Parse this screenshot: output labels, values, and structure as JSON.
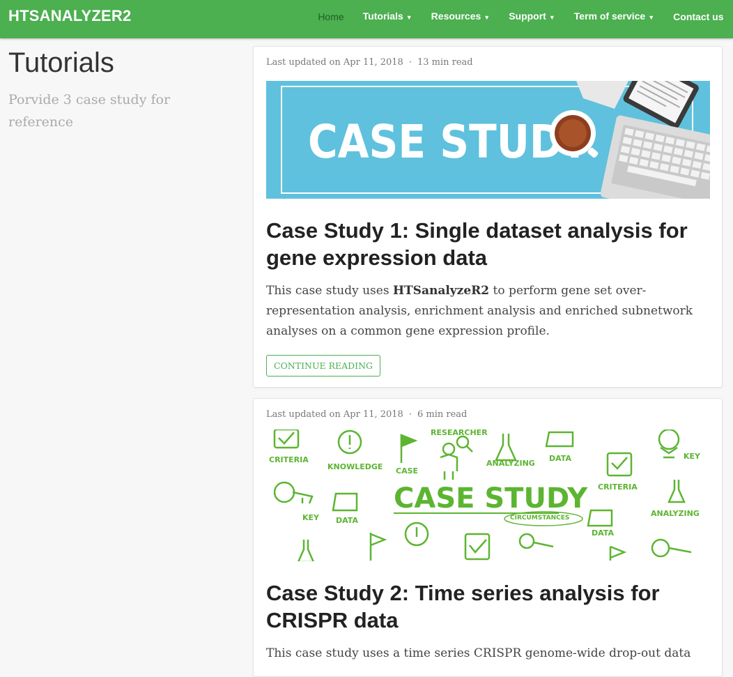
{
  "navbar": {
    "brand": "HTSANALYZER2",
    "items": [
      {
        "label": "Home",
        "dropdown": false,
        "active": true
      },
      {
        "label": "Tutorials",
        "dropdown": true
      },
      {
        "label": "Resources",
        "dropdown": true
      },
      {
        "label": "Support",
        "dropdown": true
      },
      {
        "label": "Term of service",
        "dropdown": true
      },
      {
        "label": "Contact us",
        "dropdown": false
      }
    ],
    "caret": "▼"
  },
  "sidebar": {
    "title": "Tutorials",
    "subtitle": "Porvide 3 case study for reference"
  },
  "posts": [
    {
      "meta_date": "Last updated on Apr 11, 2018",
      "meta_sep": "·",
      "meta_read": "13 min read",
      "image_text": "CASE STUDY",
      "title": "Case Study 1: Single dataset analysis for gene expression data",
      "summary_pre": "This case study uses ",
      "summary_bold": "HTSanalyzeR2",
      "summary_post": " to perform gene set over-representation analysis, enrichment analysis and enriched subnetwork analyses on a common gene expression profile.",
      "button": "CONTINUE READING"
    },
    {
      "meta_date": "Last updated on Apr 11, 2018",
      "meta_sep": "·",
      "meta_read": "6 min read",
      "image_text": "CASE STUDY",
      "image_words": [
        "CRITERIA",
        "KNOWLEDGE",
        "CASE",
        "RESEARCHER",
        "ANALYZING",
        "DATA",
        "KEY",
        "CRITERIA",
        "KEY",
        "DATA",
        "CIRCUMSTANCES",
        "DATA",
        "ANALYZING"
      ],
      "title": "Case Study 2: Time series analysis for CRISPR data",
      "summary": "This case study uses a time series CRISPR genome-wide drop-out data"
    }
  ],
  "colors": {
    "brand_green": "#4caf50",
    "case1_bg": "#5fc1dd",
    "case2_ink": "#5cb531"
  }
}
